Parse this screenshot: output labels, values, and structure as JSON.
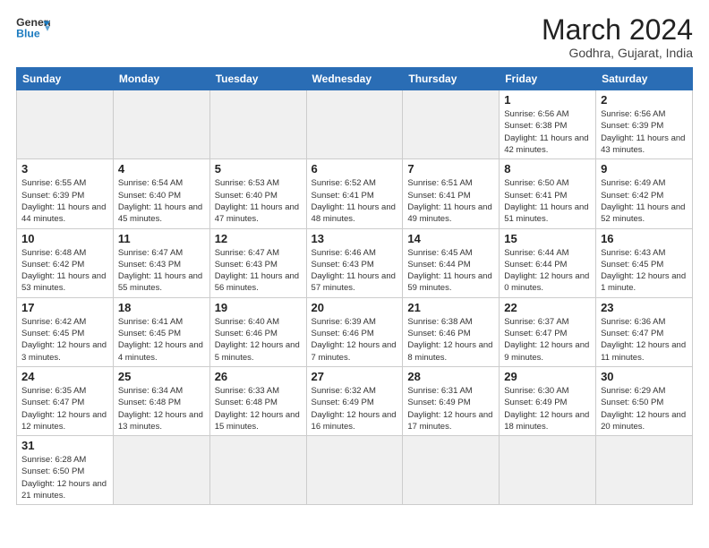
{
  "logo": {
    "line1": "General",
    "line2": "Blue"
  },
  "title": "March 2024",
  "subtitle": "Godhra, Gujarat, India",
  "days_of_week": [
    "Sunday",
    "Monday",
    "Tuesday",
    "Wednesday",
    "Thursday",
    "Friday",
    "Saturday"
  ],
  "weeks": [
    [
      {
        "day": "",
        "info": ""
      },
      {
        "day": "",
        "info": ""
      },
      {
        "day": "",
        "info": ""
      },
      {
        "day": "",
        "info": ""
      },
      {
        "day": "",
        "info": ""
      },
      {
        "day": "1",
        "info": "Sunrise: 6:56 AM\nSunset: 6:38 PM\nDaylight: 11 hours\nand 42 minutes."
      },
      {
        "day": "2",
        "info": "Sunrise: 6:56 AM\nSunset: 6:39 PM\nDaylight: 11 hours\nand 43 minutes."
      }
    ],
    [
      {
        "day": "3",
        "info": "Sunrise: 6:55 AM\nSunset: 6:39 PM\nDaylight: 11 hours\nand 44 minutes."
      },
      {
        "day": "4",
        "info": "Sunrise: 6:54 AM\nSunset: 6:40 PM\nDaylight: 11 hours\nand 45 minutes."
      },
      {
        "day": "5",
        "info": "Sunrise: 6:53 AM\nSunset: 6:40 PM\nDaylight: 11 hours\nand 47 minutes."
      },
      {
        "day": "6",
        "info": "Sunrise: 6:52 AM\nSunset: 6:41 PM\nDaylight: 11 hours\nand 48 minutes."
      },
      {
        "day": "7",
        "info": "Sunrise: 6:51 AM\nSunset: 6:41 PM\nDaylight: 11 hours\nand 49 minutes."
      },
      {
        "day": "8",
        "info": "Sunrise: 6:50 AM\nSunset: 6:41 PM\nDaylight: 11 hours\nand 51 minutes."
      },
      {
        "day": "9",
        "info": "Sunrise: 6:49 AM\nSunset: 6:42 PM\nDaylight: 11 hours\nand 52 minutes."
      }
    ],
    [
      {
        "day": "10",
        "info": "Sunrise: 6:48 AM\nSunset: 6:42 PM\nDaylight: 11 hours\nand 53 minutes."
      },
      {
        "day": "11",
        "info": "Sunrise: 6:47 AM\nSunset: 6:43 PM\nDaylight: 11 hours\nand 55 minutes."
      },
      {
        "day": "12",
        "info": "Sunrise: 6:47 AM\nSunset: 6:43 PM\nDaylight: 11 hours\nand 56 minutes."
      },
      {
        "day": "13",
        "info": "Sunrise: 6:46 AM\nSunset: 6:43 PM\nDaylight: 11 hours\nand 57 minutes."
      },
      {
        "day": "14",
        "info": "Sunrise: 6:45 AM\nSunset: 6:44 PM\nDaylight: 11 hours\nand 59 minutes."
      },
      {
        "day": "15",
        "info": "Sunrise: 6:44 AM\nSunset: 6:44 PM\nDaylight: 12 hours\nand 0 minutes."
      },
      {
        "day": "16",
        "info": "Sunrise: 6:43 AM\nSunset: 6:45 PM\nDaylight: 12 hours\nand 1 minute."
      }
    ],
    [
      {
        "day": "17",
        "info": "Sunrise: 6:42 AM\nSunset: 6:45 PM\nDaylight: 12 hours\nand 3 minutes."
      },
      {
        "day": "18",
        "info": "Sunrise: 6:41 AM\nSunset: 6:45 PM\nDaylight: 12 hours\nand 4 minutes."
      },
      {
        "day": "19",
        "info": "Sunrise: 6:40 AM\nSunset: 6:46 PM\nDaylight: 12 hours\nand 5 minutes."
      },
      {
        "day": "20",
        "info": "Sunrise: 6:39 AM\nSunset: 6:46 PM\nDaylight: 12 hours\nand 7 minutes."
      },
      {
        "day": "21",
        "info": "Sunrise: 6:38 AM\nSunset: 6:46 PM\nDaylight: 12 hours\nand 8 minutes."
      },
      {
        "day": "22",
        "info": "Sunrise: 6:37 AM\nSunset: 6:47 PM\nDaylight: 12 hours\nand 9 minutes."
      },
      {
        "day": "23",
        "info": "Sunrise: 6:36 AM\nSunset: 6:47 PM\nDaylight: 12 hours\nand 11 minutes."
      }
    ],
    [
      {
        "day": "24",
        "info": "Sunrise: 6:35 AM\nSunset: 6:47 PM\nDaylight: 12 hours\nand 12 minutes."
      },
      {
        "day": "25",
        "info": "Sunrise: 6:34 AM\nSunset: 6:48 PM\nDaylight: 12 hours\nand 13 minutes."
      },
      {
        "day": "26",
        "info": "Sunrise: 6:33 AM\nSunset: 6:48 PM\nDaylight: 12 hours\nand 15 minutes."
      },
      {
        "day": "27",
        "info": "Sunrise: 6:32 AM\nSunset: 6:49 PM\nDaylight: 12 hours\nand 16 minutes."
      },
      {
        "day": "28",
        "info": "Sunrise: 6:31 AM\nSunset: 6:49 PM\nDaylight: 12 hours\nand 17 minutes."
      },
      {
        "day": "29",
        "info": "Sunrise: 6:30 AM\nSunset: 6:49 PM\nDaylight: 12 hours\nand 18 minutes."
      },
      {
        "day": "30",
        "info": "Sunrise: 6:29 AM\nSunset: 6:50 PM\nDaylight: 12 hours\nand 20 minutes."
      }
    ],
    [
      {
        "day": "31",
        "info": "Sunrise: 6:28 AM\nSunset: 6:50 PM\nDaylight: 12 hours\nand 21 minutes."
      },
      {
        "day": "",
        "info": ""
      },
      {
        "day": "",
        "info": ""
      },
      {
        "day": "",
        "info": ""
      },
      {
        "day": "",
        "info": ""
      },
      {
        "day": "",
        "info": ""
      },
      {
        "day": "",
        "info": ""
      }
    ]
  ]
}
